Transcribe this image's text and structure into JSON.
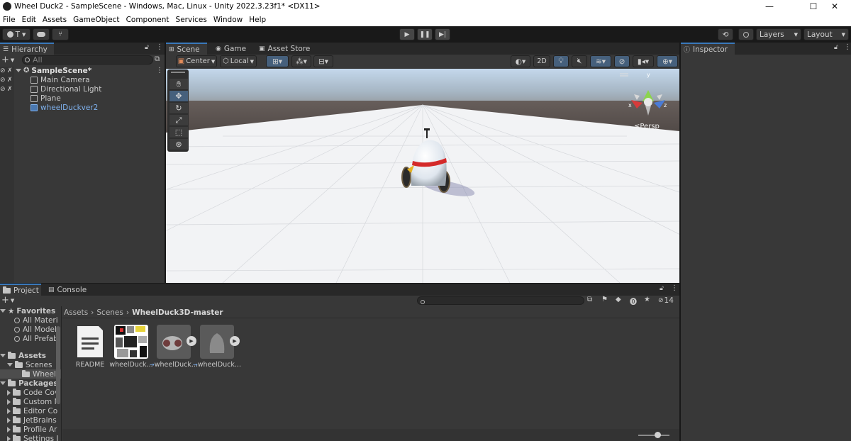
{
  "window": {
    "title": "Wheel Duck2 - SampleScene - Windows, Mac, Linux - Unity 2022.3.23f1* <DX11>",
    "minimize": "—",
    "maximize": "☐",
    "close": "✕"
  },
  "menu": [
    "File",
    "Edit",
    "Assets",
    "GameObject",
    "Component",
    "Services",
    "Window",
    "Help"
  ],
  "toolbar": {
    "account": "T",
    "layers": "Layers",
    "layout": "Layout"
  },
  "hierarchy": {
    "tab": "Hierarchy",
    "search_placeholder": "All",
    "scene": "SampleScene*",
    "items": [
      "Main Camera",
      "Directional Light",
      "Plane",
      "wheelDuckver2"
    ]
  },
  "scene_tabs": [
    "Scene",
    "Game",
    "Asset Store"
  ],
  "scene_toolbar": {
    "pivot": "Center",
    "space": "Local",
    "mode2d": "2D"
  },
  "gizmo": {
    "x": "x",
    "y": "y",
    "z": "z",
    "persp": "≤Persp"
  },
  "inspector": {
    "tab": "Inspector"
  },
  "project": {
    "tabs": [
      "Project",
      "Console"
    ],
    "hidden_count": "14",
    "favorites_label": "Favorites",
    "favorites": [
      "All Materi",
      "All Model",
      "All Prefab"
    ],
    "assets_label": "Assets",
    "scenes_label": "Scenes",
    "scenes_child": "Wheell",
    "packages_label": "Packages",
    "packages": [
      "Code Cov",
      "Custom N",
      "Editor Co",
      "JetBrains",
      "Profile Ar",
      "Settings I"
    ],
    "breadcrumb": [
      "Assets",
      "Scenes",
      "WheelDuck3D-master"
    ],
    "assets": [
      "README",
      "wheelDuck...",
      "wheelDuck...",
      "wheelDuck..."
    ]
  },
  "colors": {
    "accent": "#3a79bb",
    "selection": "#46607c",
    "panel": "#383838",
    "dark": "#191919"
  }
}
